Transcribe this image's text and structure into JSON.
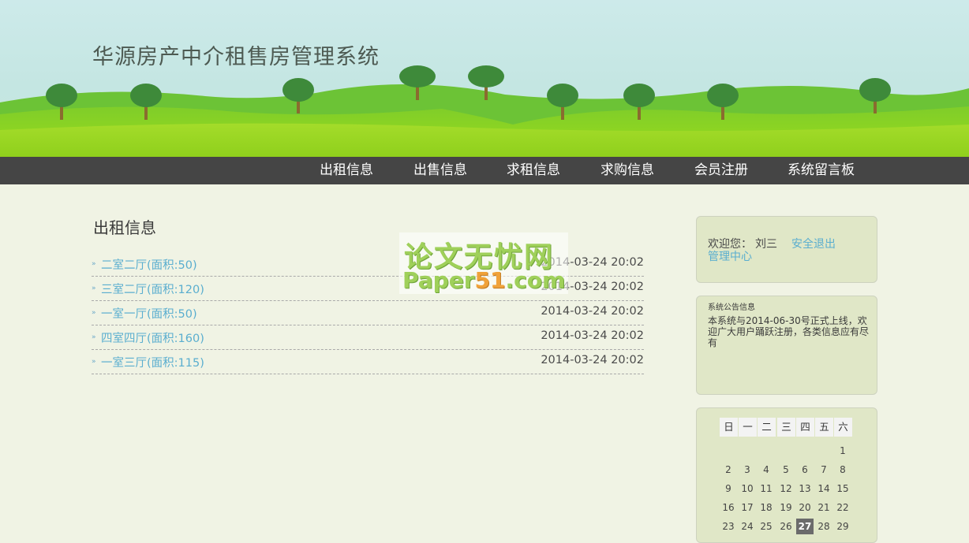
{
  "header": {
    "title": "华源房产中介租售房管理系统"
  },
  "nav": {
    "items": [
      "出租信息",
      "出售信息",
      "求租信息",
      "求购信息",
      "会员注册",
      "系统留言板"
    ]
  },
  "main": {
    "section_title": "出租信息",
    "items": [
      {
        "title": "二室二厅(面积:50)",
        "date": "2014-03-24 20:02"
      },
      {
        "title": "三室二厅(面积:120)",
        "date": "2014-03-24 20:02"
      },
      {
        "title": "一室一厅(面积:50)",
        "date": "2014-03-24 20:02"
      },
      {
        "title": "四室四厅(面积:160)",
        "date": "2014-03-24 20:02"
      },
      {
        "title": "一室三厅(面积:115)",
        "date": "2014-03-24 20:02"
      }
    ]
  },
  "watermark": {
    "line1": "论文无忧网",
    "line2_a": "Paper",
    "line2_b": "51",
    "line2_c": ".com"
  },
  "sidebar": {
    "welcome_label": "欢迎您：",
    "username": "刘三",
    "logout_link": "安全退出",
    "admin_link": "管理中心",
    "notice_title": "系统公告信息",
    "notice_text": "本系统与2014-06-30号正式上线，欢迎广大用户踊跃注册，各类信息应有尽有",
    "calendar": {
      "weekdays": [
        "日",
        "一",
        "二",
        "三",
        "四",
        "五",
        "六"
      ],
      "weeks": [
        [
          "",
          "",
          "",
          "",
          "",
          "",
          "1"
        ],
        [
          "2",
          "3",
          "4",
          "5",
          "6",
          "7",
          "8"
        ],
        [
          "9",
          "10",
          "11",
          "12",
          "13",
          "14",
          "15"
        ],
        [
          "16",
          "17",
          "18",
          "19",
          "20",
          "21",
          "22"
        ],
        [
          "23",
          "24",
          "25",
          "26",
          "27",
          "28",
          "29"
        ]
      ],
      "today": "27"
    }
  },
  "colors": {
    "nav_bg": "#454545",
    "link": "#5aaecf",
    "page_bg": "#f0f3e4",
    "sidebar_box": "#e0e7c7",
    "hill_green": "#8fd22a",
    "tree_green": "#3e8a3a"
  }
}
